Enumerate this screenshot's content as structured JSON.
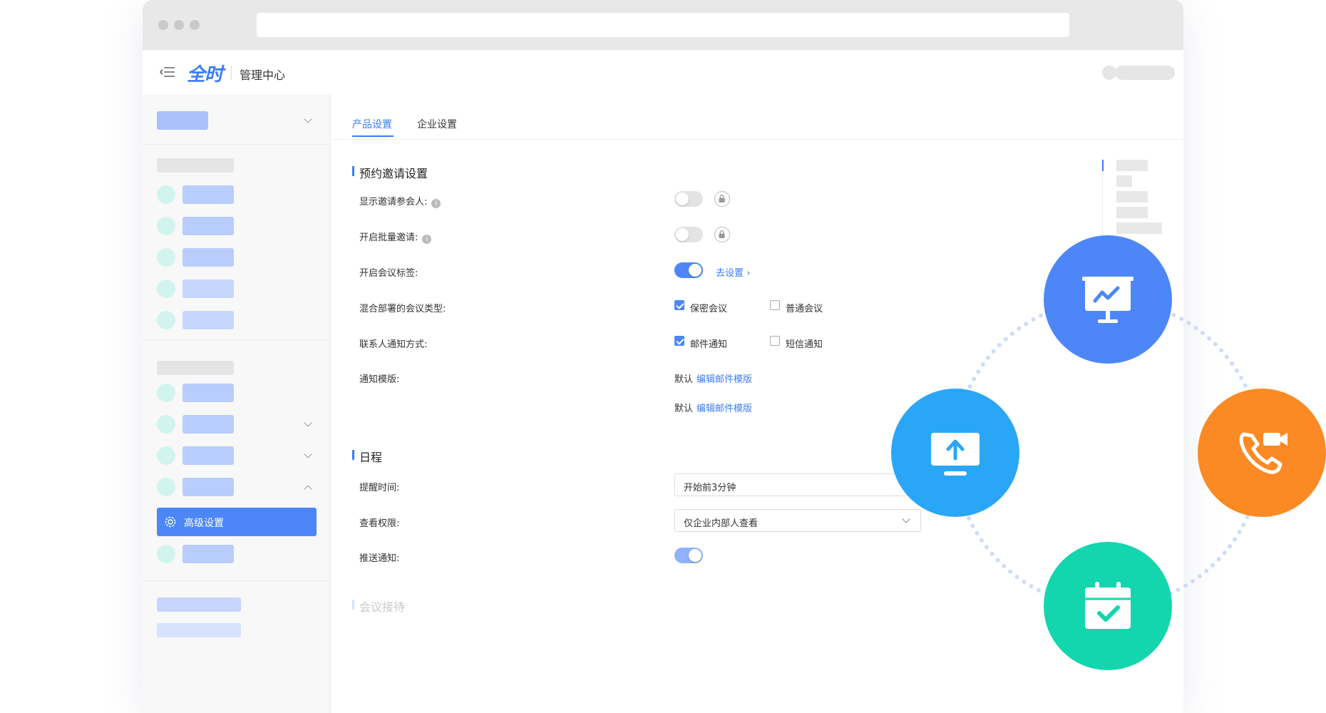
{
  "header": {
    "logo_text": "全时",
    "app_title": "管理中心"
  },
  "sidebar": {
    "active_item_label": "高级设置",
    "icons": [
      "chevron-down-icon",
      "gear-icon",
      "chevron-up-icon"
    ]
  },
  "tabs": [
    "产品设置",
    "企业设置"
  ],
  "sections": {
    "invite": {
      "title": "预约邀请设置",
      "show_invitees_label": "显示邀请参会人:",
      "batch_invite_label": "开启批量邀请:",
      "meeting_tags_label": "开启会议标签:",
      "meeting_tags_link": "去设置",
      "hybrid_types_label": "混合部署的会议类型:",
      "hybrid_options": [
        {
          "label": "保密会议",
          "checked": true
        },
        {
          "label": "普通会议",
          "checked": false
        }
      ],
      "contact_notify_label": "联系人通知方式:",
      "notify_options": [
        {
          "label": "邮件通知",
          "checked": true
        },
        {
          "label": "短信通知",
          "checked": false
        }
      ],
      "template_label": "通知模版:",
      "template_rows": [
        {
          "default_text": "默认",
          "link": "编辑邮件模版"
        },
        {
          "default_text": "默认",
          "link": "编辑邮件模版"
        }
      ]
    },
    "schedule": {
      "title": "日程",
      "reminder_label": "提醒时间:",
      "reminder_value": "开始前3分钟",
      "permission_label": "查看权限:",
      "permission_value": "仅企业内部人查看",
      "push_label": "推送通知:"
    },
    "reception": {
      "title": "会议接待"
    }
  },
  "toggles": {
    "show_invitees": false,
    "batch_invite": false,
    "meeting_tags": true,
    "push_notify": true
  },
  "feature_icons": [
    "presentation-icon",
    "screen-share-icon",
    "video-call-icon",
    "calendar-check-icon"
  ],
  "colors": {
    "accent": "#3b7cf6",
    "presentation": "#4d87f7",
    "share": "#2aa6f7",
    "call": "#fb8a25",
    "calendar": "#13d6ae"
  }
}
